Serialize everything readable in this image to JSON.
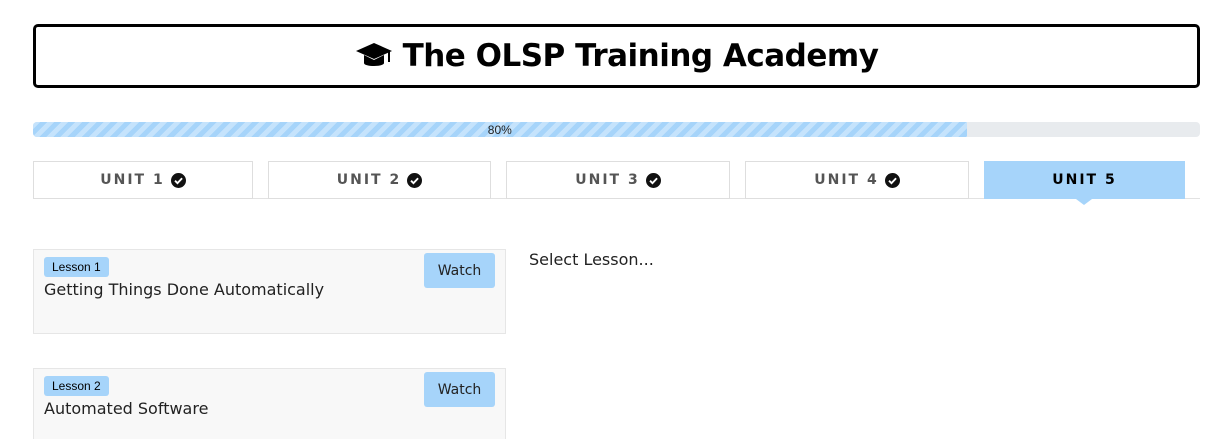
{
  "header": {
    "title": "The OLSP Training Academy",
    "icon": "graduation-cap-icon"
  },
  "progress": {
    "value": 0.8,
    "label": "80%",
    "color": "#a6d4fa"
  },
  "tabs": [
    {
      "label": "UNIT 1",
      "completed": true
    },
    {
      "label": "UNIT 2",
      "completed": true
    },
    {
      "label": "UNIT 3",
      "completed": true
    },
    {
      "label": "UNIT 4",
      "completed": true
    },
    {
      "label": "UNIT 5",
      "completed": false,
      "active": true
    }
  ],
  "lessons": [
    {
      "badge": "Lesson 1",
      "title": "Getting Things Done Automatically",
      "button": "Watch"
    },
    {
      "badge": "Lesson 2",
      "title": "Automated Software",
      "button": "Watch"
    }
  ],
  "content": {
    "placeholder": "Select Lesson..."
  },
  "colors": {
    "accent": "#a6d4fa",
    "border": "#000000"
  }
}
